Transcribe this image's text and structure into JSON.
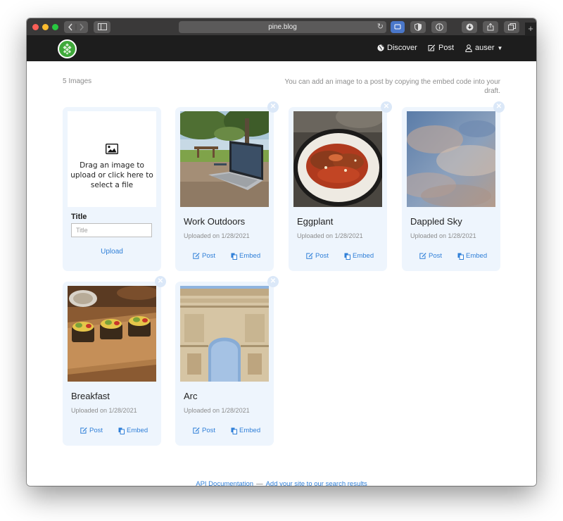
{
  "browser": {
    "url": "pine.blog"
  },
  "nav": {
    "discover": "Discover",
    "post": "Post",
    "user": "auser"
  },
  "page": {
    "count": "5 Images",
    "hint": "You can add an image to a post by copying the embed code into your draft."
  },
  "upload": {
    "dropzone_text": "Drag an image to upload or click here to select a file",
    "title_label": "Title",
    "title_placeholder": "Title",
    "upload_label": "Upload"
  },
  "images": [
    {
      "title": "Work Outdoors",
      "uploaded": "Uploaded on 1/28/2021",
      "post": "Post",
      "embed": "Embed"
    },
    {
      "title": "Eggplant",
      "uploaded": "Uploaded on 1/28/2021",
      "post": "Post",
      "embed": "Embed"
    },
    {
      "title": "Dappled Sky",
      "uploaded": "Uploaded on 1/28/2021",
      "post": "Post",
      "embed": "Embed"
    },
    {
      "title": "Breakfast",
      "uploaded": "Uploaded on 1/28/2021",
      "post": "Post",
      "embed": "Embed"
    },
    {
      "title": "Arc",
      "uploaded": "Uploaded on 1/28/2021",
      "post": "Post",
      "embed": "Embed"
    }
  ],
  "footer": {
    "api_docs": "API Documentation",
    "separator": "—",
    "add_site": "Add your site to our search results"
  },
  "colors": {
    "accent": "#2f7fd8",
    "card_bg": "#eef5fd",
    "nav_bg": "#1d1d1d",
    "logo_green": "#3fa93a"
  }
}
